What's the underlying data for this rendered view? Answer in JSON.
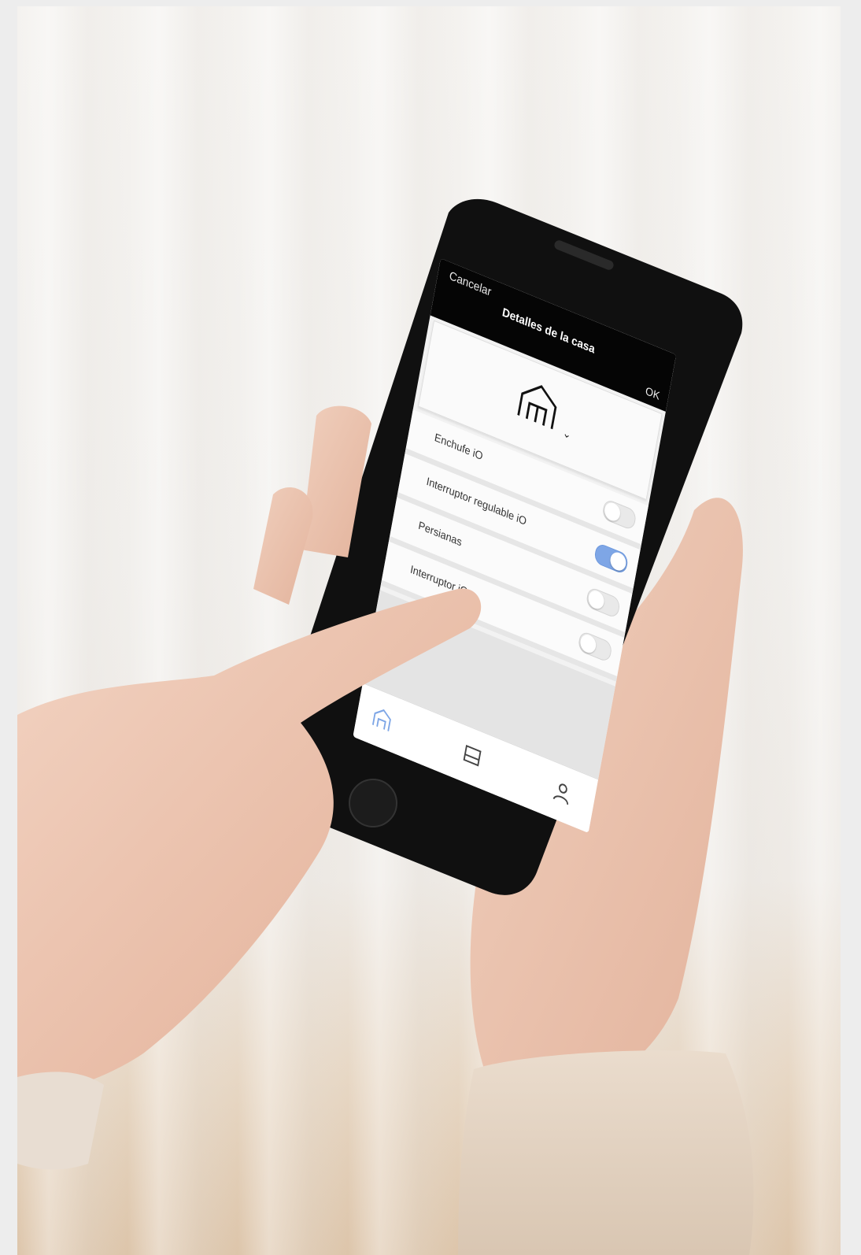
{
  "header": {
    "cancel_label": "Cancelar",
    "title": "Detalles de la casa",
    "ok_label": "OK"
  },
  "house_selector": {
    "icon": "house-icon",
    "chevron": "⌄"
  },
  "devices": [
    {
      "label": "Enchufe iO",
      "enabled": false
    },
    {
      "label": "Interruptor regulable iO",
      "enabled": true
    },
    {
      "label": "Persianas",
      "enabled": false
    },
    {
      "label": "Interruptor iO",
      "enabled": false
    }
  ],
  "tabbar": {
    "items": [
      {
        "icon": "home-icon",
        "active": true
      },
      {
        "icon": "storage-box-icon",
        "active": false
      },
      {
        "icon": "user-icon",
        "active": false
      }
    ]
  },
  "colors": {
    "accent": "#7ea6e6",
    "topbar": "#050505",
    "background": "#f2f2f2"
  }
}
